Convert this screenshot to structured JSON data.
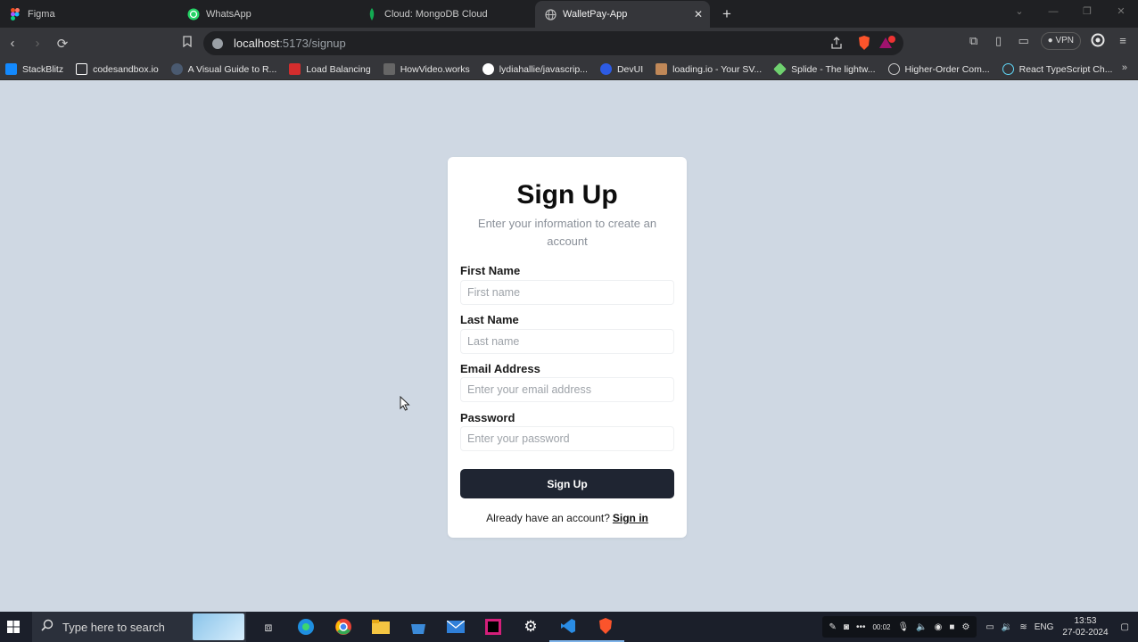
{
  "browser": {
    "tabs": [
      {
        "label": "Figma",
        "icon": "figma-icon",
        "active": false
      },
      {
        "label": "WhatsApp",
        "icon": "whatsapp-icon",
        "active": false
      },
      {
        "label": "Cloud: MongoDB Cloud",
        "icon": "mongodb-icon",
        "active": false
      },
      {
        "label": "WalletPay-App",
        "icon": "globe-icon",
        "active": true
      }
    ],
    "url_host": "localhost",
    "url_path": ":5173/signup",
    "vpn_label": "VPN",
    "bookmarks": [
      {
        "label": "StackBlitz",
        "color": "#1389fd"
      },
      {
        "label": "codesandbox.io",
        "color": "#ffffff"
      },
      {
        "label": "A Visual Guide to R...",
        "color": "#4a5a70"
      },
      {
        "label": "Load Balancing",
        "color": "#d42d2d"
      },
      {
        "label": "HowVideo.works",
        "color": "#666666"
      },
      {
        "label": "lydiahallie/javascrip...",
        "color": "#ffffff"
      },
      {
        "label": "DevUI",
        "color": "#2d5be3"
      },
      {
        "label": "loading.io - Your SV...",
        "color": "#c08858"
      },
      {
        "label": "Splide - The lightw...",
        "color": "#6fd16f"
      },
      {
        "label": "Higher-Order Com...",
        "color": "#cccccc"
      },
      {
        "label": "React TypeScript Ch...",
        "color": "#61dafb"
      }
    ]
  },
  "signup": {
    "title": "Sign Up",
    "subtitle": "Enter your information to create an account",
    "fields": [
      {
        "label": "First Name",
        "placeholder": "First name"
      },
      {
        "label": "Last Name",
        "placeholder": "Last name"
      },
      {
        "label": "Email Address",
        "placeholder": "Enter your email address"
      },
      {
        "label": "Password",
        "placeholder": "Enter your password"
      }
    ],
    "button_label": "Sign Up",
    "footer_text": "Already have an account?",
    "signin_label": "Sign in"
  },
  "taskbar": {
    "search_placeholder": "Type here to search",
    "recording_time": "00:02",
    "language": "ENG",
    "time": "13:53",
    "date": "27-02-2024"
  },
  "colors": {
    "page_bg": "#cfd8e3",
    "button_bg": "#1f2532",
    "card_bg": "#ffffff"
  }
}
